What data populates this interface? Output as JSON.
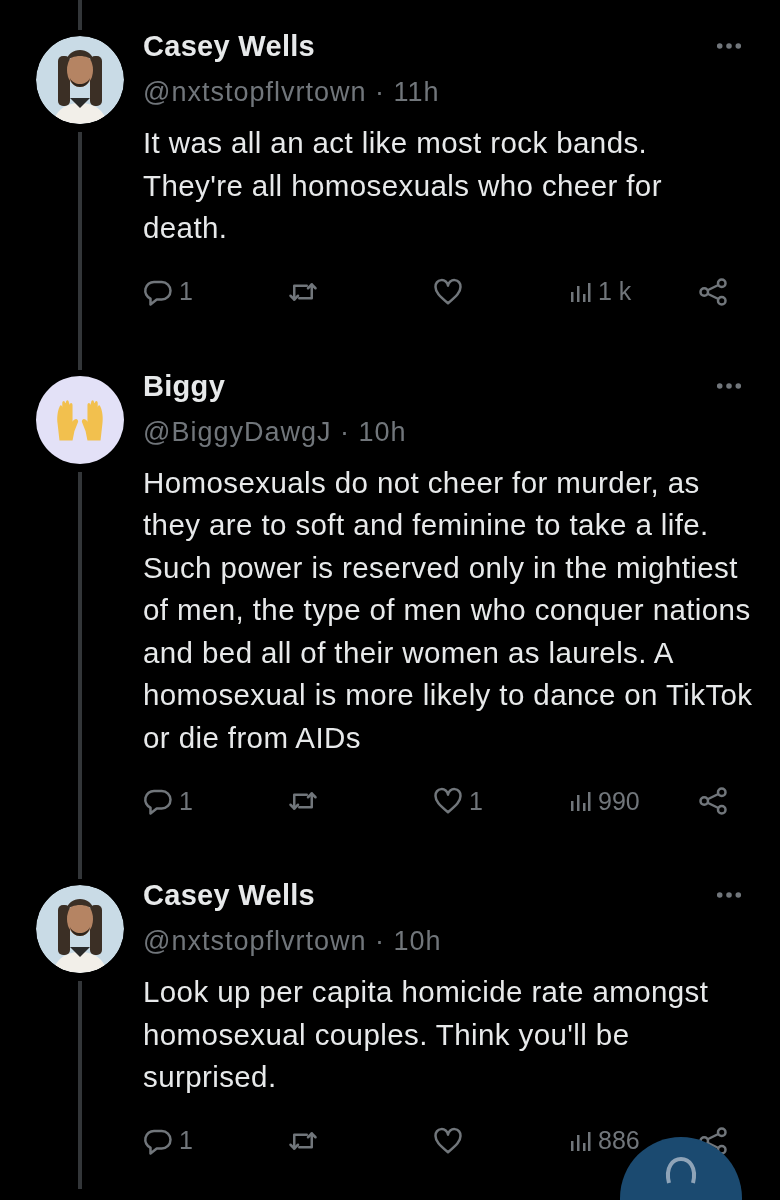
{
  "posts": [
    {
      "author": "Casey Wells",
      "handle": "@nxtstopflvrtown",
      "separator": "·",
      "time": "11h",
      "text": "It was all an act like most rock bands. They're all homosexuals who cheer for death.",
      "replies": "1",
      "views": "1 k"
    },
    {
      "author": "Biggy",
      "handle": "@BiggyDawgJ",
      "separator": "·",
      "time": "10h",
      "avatar": {
        "kind": "icon"
      },
      "text": "Homosexuals do not cheer for murder, as they are to soft and feminine to take a life. Such power is reserved only in the mightiest of men, the type of men who conquer nations and bed all of their women as laurels. A homosexual is more likely to dance on TikTok or die from AIDs",
      "replies": "1",
      "likes": "1",
      "views": "990"
    },
    {
      "author": "Casey Wells",
      "handle": "@nxtstopflvrtown",
      "separator": "·",
      "time": "10h",
      "text": "Look up per capita homicide rate amongst homosexual couples. Think you'll be surprised.",
      "replies": "1",
      "views": "886"
    }
  ],
  "compose_button": {
    "kind": "floating"
  }
}
